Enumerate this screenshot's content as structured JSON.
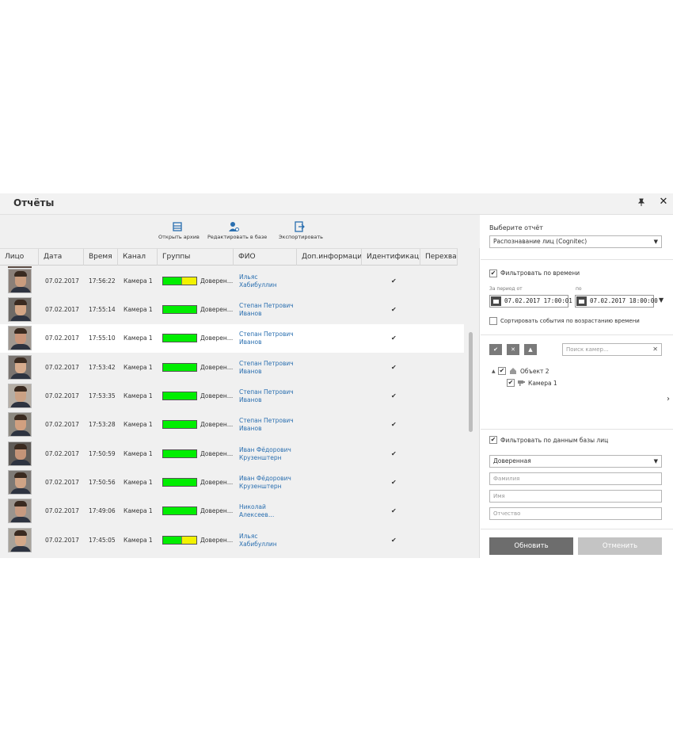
{
  "window": {
    "title": "Отчёты",
    "pin_icon": "pin-icon",
    "close_icon": "close-icon"
  },
  "toolbar": {
    "open_archive": "Открыть архив",
    "edit_in_db": "Редактировать в базе",
    "export": "Экспортировать"
  },
  "table": {
    "columns": [
      "Лицо",
      "Дата",
      "Время",
      "Канал",
      "Группы",
      "ФИО",
      "Доп.информация",
      "Идентификац",
      "Перехва"
    ],
    "rows": [
      {
        "date": "07.02.2017",
        "time": "17:56:22",
        "channel": "Камера 1",
        "group": "Доверен…",
        "name1": "Ильяс",
        "name2": "Хабибуллин",
        "match": 0.55,
        "check": "✔"
      },
      {
        "date": "07.02.2017",
        "time": "17:55:14",
        "channel": "Камера 1",
        "group": "Доверен…",
        "name1": "Степан Петрович",
        "name2": "Иванов",
        "match": 1.0,
        "check": "✔"
      },
      {
        "date": "07.02.2017",
        "time": "17:55:10",
        "channel": "Камера 1",
        "group": "Доверен…",
        "name1": "Степан Петрович",
        "name2": "Иванов",
        "match": 1.0,
        "check": "✔"
      },
      {
        "date": "07.02.2017",
        "time": "17:53:42",
        "channel": "Камера 1",
        "group": "Доверен…",
        "name1": "Степан Петрович",
        "name2": "Иванов",
        "match": 1.0,
        "check": "✔"
      },
      {
        "date": "07.02.2017",
        "time": "17:53:35",
        "channel": "Камера 1",
        "group": "Доверен…",
        "name1": "Степан Петрович",
        "name2": "Иванов",
        "match": 1.0,
        "check": "✔"
      },
      {
        "date": "07.02.2017",
        "time": "17:53:28",
        "channel": "Камера 1",
        "group": "Доверен…",
        "name1": "Степан Петрович",
        "name2": "Иванов",
        "match": 1.0,
        "check": "✔"
      },
      {
        "date": "07.02.2017",
        "time": "17:50:59",
        "channel": "Камера 1",
        "group": "Доверен…",
        "name1": "Иван Фёдорович",
        "name2": "Крузенштерн",
        "match": 1.0,
        "check": "✔"
      },
      {
        "date": "07.02.2017",
        "time": "17:50:56",
        "channel": "Камера 1",
        "group": "Доверен…",
        "name1": "Иван Фёдорович",
        "name2": "Крузенштерн",
        "match": 1.0,
        "check": "✔"
      },
      {
        "date": "07.02.2017",
        "time": "17:49:06",
        "channel": "Камера 1",
        "group": "Доверен…",
        "name1": "Николай",
        "name2": "Алексеев…",
        "match": 1.0,
        "check": "✔"
      },
      {
        "date": "07.02.2017",
        "time": "17:45:05",
        "channel": "Камера 1",
        "group": "Доверен…",
        "name1": "Ильяс",
        "name2": "Хабибуллин",
        "match": 0.55,
        "check": "✔"
      }
    ]
  },
  "panel": {
    "report_label": "Выберите отчёт",
    "report_value": "Распознавание лиц (Cognitec)",
    "filter_time_label": "Фильтровать по времени",
    "period_from_label": "За период от",
    "period_to_label": "по",
    "date_from": "07.02.2017 17:00:01",
    "date_to": "07.02.2017 18:00:00",
    "sort_label": "Сортировать события по возрастанию времени",
    "camera_search_placeholder": "Поиск камер...",
    "tree_object": "Объект 2",
    "tree_camera": "Камера 1",
    "filter_db_label": "Фильтровать по данным базы лиц",
    "group_value": "Доверенная",
    "surname_placeholder": "Фамилия",
    "name_placeholder": "Имя",
    "patronymic_placeholder": "Отчество",
    "refresh_button": "Обновить",
    "cancel_button": "Отменить",
    "check_mark": "✔"
  },
  "colors": {
    "match_green": "#00ee00",
    "match_yellow": "#f2f200",
    "link_blue": "#2a6fb0",
    "button_dark": "#6d6d6d",
    "button_light": "#c4c4c4"
  }
}
